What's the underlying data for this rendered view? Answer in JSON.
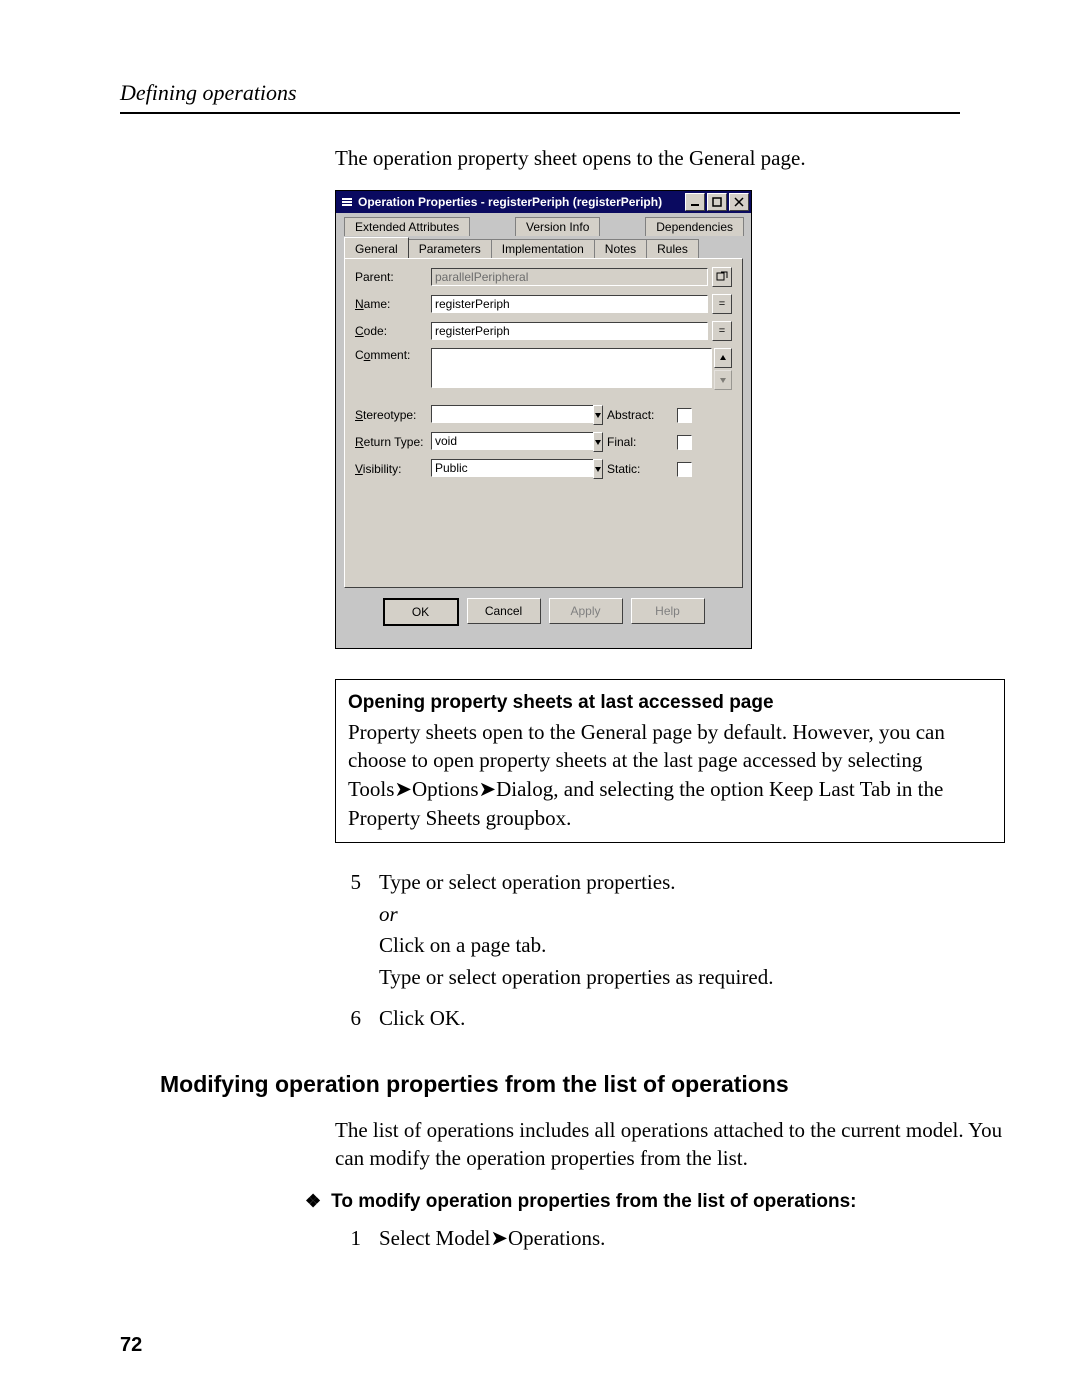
{
  "page_header": "Defining operations",
  "intro_para": "The operation property sheet opens to the General page.",
  "dialog": {
    "title": "Operation Properties - registerPeriph (registerPeriph)",
    "tabs_row1": [
      "Extended Attributes",
      "Version Info",
      "Dependencies"
    ],
    "tabs_row2": [
      "General",
      "Parameters",
      "Implementation",
      "Notes",
      "Rules"
    ],
    "labels": {
      "parent": "Parent:",
      "name": "Name:",
      "code": "Code:",
      "comment": "Comment:",
      "stereotype": "Stereotype:",
      "return_type": "Return Type:",
      "visibility": "Visibility:",
      "abstract": "Abstract:",
      "final": "Final:",
      "static": "Static:"
    },
    "values": {
      "parent": "parallelPeripheral",
      "name": "registerPeriph",
      "code": "registerPeriph",
      "comment": "",
      "stereotype": "",
      "return_type": "void",
      "visibility": "Public"
    },
    "buttons": {
      "ok": "OK",
      "cancel": "Cancel",
      "apply": "Apply",
      "help": "Help"
    }
  },
  "infobox": {
    "title": "Opening property sheets at last accessed page",
    "body_prefix": "Property sheets open to the General page by default. However, you can choose to open property sheets at the last page accessed by selecting Tools",
    "body_mid1": "Options",
    "body_mid2": "Dialog, and selecting the option Keep Last Tab in the Property Sheets groupbox."
  },
  "steps1": [
    {
      "num": "5",
      "line1": "Type or select operation properties.",
      "or": "or",
      "line2": "Click on a page tab.",
      "line3": "Type or select operation properties as required."
    },
    {
      "num": "6",
      "line1": "Click OK."
    }
  ],
  "h2": "Modifying operation properties from the list of operations",
  "para2": "The list of operations includes all operations attached to the current model. You can modify the operation properties from the list.",
  "task_line": "To modify operation properties from the list of operations:",
  "steps2": [
    {
      "num": "1",
      "prefix": "Select Model",
      "suffix": "Operations."
    }
  ],
  "page_num": "72"
}
